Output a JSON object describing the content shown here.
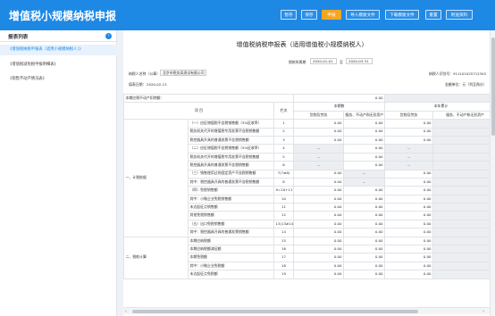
{
  "app_title": "增值税小规模纳税申报",
  "toolbar": [
    "暂存",
    "保存",
    "申报",
    "导入模板文件",
    "下载模板文件",
    "重置",
    "附送资料"
  ],
  "sidebar": {
    "title": "报表列表",
    "items": [
      "《增值税纳税申报表（适用小规模纳税人）》",
      "《增值税减免税申报明细表》",
      "《销售不动产情况表》"
    ]
  },
  "form": {
    "title": "增值税纳税申报表（适用增值税小规模纳税人）",
    "period_label": "税款所属期",
    "period_from": "2020-01-01",
    "period_to_label": "至",
    "period_to": "2020-03-31",
    "taxpayer_name_label": "纳税人名称（公章）：",
    "taxpayer_name": "北京市税务局测试有限公司",
    "taxpayer_id_label": "纳税人识别号：",
    "taxpayer_id": "911101025712345",
    "fill_date_label": "填表日期：",
    "fill_date": "2020-02-13",
    "amount_unit": "金额单位：元（列至角分）",
    "top_row_label": "本期应税不动产扣除额：",
    "top_row_value": "0.00"
  },
  "table": {
    "headers": {
      "item": "项 目",
      "lineno": "栏次",
      "current": "本期数",
      "ytd": "本年累计",
      "goods": "货物及劳务",
      "services": "服务、不动产和无形资产"
    },
    "section1": "一、计税依据",
    "section2": "二、税款计算",
    "rows": [
      {
        "item": "（一）应征增值税不含税销售额（3%征收率）",
        "no": "1",
        "a": "0.00",
        "b": "0.00",
        "c": "0.00"
      },
      {
        "item": "税务机关代开的增值税专用发票不含税销售额",
        "no": "2",
        "a": "0.00",
        "b": "0.00",
        "c": "0.00"
      },
      {
        "item": "税控器具开具的普通发票不含税销售额",
        "no": "3",
        "a": "0.00",
        "b": "0.00",
        "c": "0.00"
      },
      {
        "item": "（二）应征增值税不含税销售额（5%征收率）",
        "no": "4",
        "a": "--",
        "b": "0.00",
        "c": "--"
      },
      {
        "item": "税务机关代开的增值税专用发票不含税销售额",
        "no": "5",
        "a": "--",
        "b": "0.00",
        "c": "--"
      },
      {
        "item": "税控器具开具的普通发票不含税销售额",
        "no": "6",
        "a": "--",
        "b": "0.00",
        "c": "--"
      },
      {
        "item": "（三）销售使用过的固定资产不含税销售额",
        "no": "7(7≥8)",
        "a": "0.00",
        "b": "--",
        "c": "0.00"
      },
      {
        "item": "其中：税控器具开具的普通发票不含税销售额",
        "no": "8",
        "a": "0.00",
        "b": "--",
        "c": "0.00"
      },
      {
        "item": "（四）免税销售额",
        "no": "9=10+11+12",
        "a": "0.00",
        "b": "0.00",
        "c": "0.00"
      },
      {
        "item": "其中：小微企业免税销售额",
        "no": "10",
        "a": "0.00",
        "b": "0.00",
        "c": "0.00"
      },
      {
        "item": "未达起征点销售额",
        "no": "11",
        "a": "0.00",
        "b": "0.00",
        "c": "0.00"
      },
      {
        "item": "其他免税销售额",
        "no": "12",
        "a": "0.00",
        "b": "0.00",
        "c": "0.00"
      },
      {
        "item": "（五）出口免税销售额",
        "no": "13(13≥14)",
        "a": "0.00",
        "b": "0.00",
        "c": "0.00"
      },
      {
        "item": "其中：税控器具开具的普通发票销售额",
        "no": "14",
        "a": "0.00",
        "b": "0.00",
        "c": "0.00"
      },
      {
        "item": "本期应纳税额",
        "no": "15",
        "a": "0.00",
        "b": "0.00",
        "c": "0.00"
      },
      {
        "item": "本期应纳税额减征额",
        "no": "16",
        "a": "0.00",
        "b": "0.00",
        "c": "0.00"
      },
      {
        "item": "本期免税额",
        "no": "17",
        "a": "0.00",
        "b": "0.00",
        "c": "0.00"
      },
      {
        "item": "其中：小微企业免税额",
        "no": "18",
        "a": "0.00",
        "b": "0.00",
        "c": "0.00"
      },
      {
        "item": "未达起征点免税额",
        "no": "19",
        "a": "0.00",
        "b": "0.00",
        "c": "0.00"
      }
    ]
  },
  "icons": {
    "collapse": "chevron-left-icon",
    "scroll_left": "arrow-left-icon",
    "scroll_right": "arrow-right-icon"
  }
}
